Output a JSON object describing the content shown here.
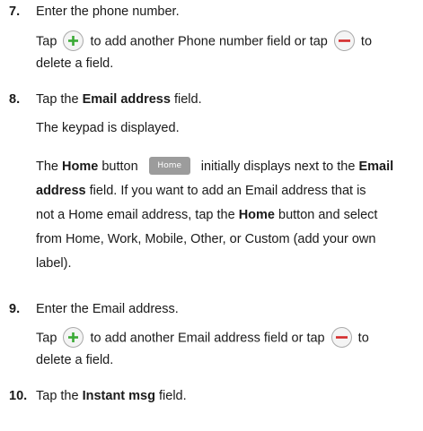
{
  "steps": [
    {
      "number": "7.",
      "line1": "Enter the phone number.",
      "tap_prefix": "Tap",
      "tap_middle": "to add another Phone number field or tap",
      "tap_suffix": "to",
      "tap_line2": "delete a field."
    },
    {
      "number": "8.",
      "tap": "Tap the",
      "field": "Email address",
      "field_after": "field.",
      "keypad": "The keypad is displayed.",
      "home_p1_a": "The",
      "home_p1_b": "Home",
      "home_p1_c": "button",
      "home_button_label": "Home",
      "home_p1_d": "initially displays next to the",
      "home_p1_e": "Email",
      "home_p2_a": "address",
      "home_p2_b": "field. If you want to add an Email address that is",
      "home_p3": "not a Home email address, tap the",
      "home_p3_b": "Home",
      "home_p3_c": "button and select",
      "home_p4": "from Home, Work, Mobile, Other, or Custom (add your own",
      "home_p5": "label)."
    },
    {
      "number": "9.",
      "line1": "Enter the Email address.",
      "tap_prefix": "Tap",
      "tap_middle": "to add another Email address field or tap",
      "tap_suffix": "to",
      "tap_line2": "delete a field."
    },
    {
      "number": "10.",
      "tap": "Tap the",
      "field": "Instant msg",
      "field_after": "field."
    }
  ],
  "icons": {
    "add": "plus-circle-icon",
    "remove": "minus-circle-icon"
  },
  "colors": {
    "add": "#3aaa35",
    "remove": "#d42a2a",
    "home_button": "#9c9c9c"
  }
}
